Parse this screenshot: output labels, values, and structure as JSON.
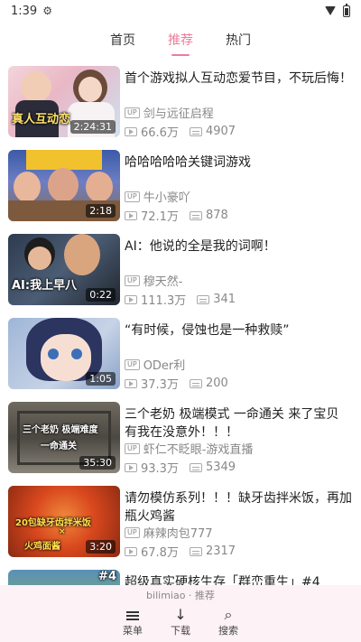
{
  "status_bar": {
    "time": "1:39"
  },
  "tabs": [
    {
      "label": "首页"
    },
    {
      "label": "推荐"
    },
    {
      "label": "热门"
    }
  ],
  "videos": [
    {
      "title": "首个游戏拟人互动恋爱节目，不玩后悔！",
      "uploader": "剑与远征启程",
      "views": "66.6万",
      "danmaku": "4907",
      "duration": "2:24:31",
      "thumb_text": "真人互动恋"
    },
    {
      "title": "哈哈哈哈哈关键词游戏",
      "uploader": "牛小豪吖",
      "views": "72.1万",
      "danmaku": "878",
      "duration": "2:18",
      "thumb_text": ""
    },
    {
      "title": "AI：他说的全是我的词啊！",
      "uploader": "穆天然-",
      "views": "111.3万",
      "danmaku": "341",
      "duration": "0:22",
      "thumb_text": "AI:我上早八"
    },
    {
      "title": "“有时候，侵蚀也是一种救赎”",
      "uploader": "ODer利",
      "views": "37.3万",
      "danmaku": "200",
      "duration": "1:05",
      "thumb_text": ""
    },
    {
      "title": "三个老奶 极端模式 一命通关 来了宝贝 有我在没意外！！！",
      "uploader": "虾仁不眨眼-游戏直播",
      "views": "93.3万",
      "danmaku": "5349",
      "duration": "35:30",
      "thumb_text": "三个老奶 极端难度",
      "thumb_text_2": "一命通关"
    },
    {
      "title": "请勿模仿系列！！！缺牙齿拌米饭，再加瓶火鸡酱",
      "uploader": "麻辣肉包777",
      "views": "67.8万",
      "danmaku": "2317",
      "duration": "3:20",
      "thumb_text": "20包缺牙齿拌米饭",
      "thumb_text_2": "×",
      "thumb_text_3": "火鸡面酱"
    },
    {
      "title": "超级真实硬核生存「群峦重生」#4",
      "uploader": "",
      "views": "",
      "danmaku": "",
      "duration": "",
      "thumb_text": "#4"
    }
  ],
  "bottom_nav": {
    "hint": "bilimiao · 推荐",
    "items": [
      {
        "label": "菜单",
        "icon": "menu-icon"
      },
      {
        "label": "下载",
        "icon": "download-icon"
      },
      {
        "label": "搜索",
        "icon": "search-icon"
      }
    ]
  },
  "colors": {
    "accent": "#f07b9b",
    "nav_bg": "#fdf2f5"
  }
}
